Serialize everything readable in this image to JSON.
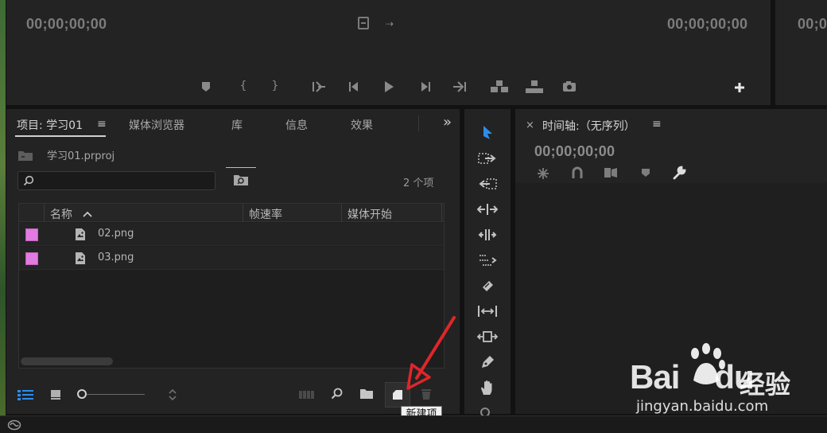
{
  "source_monitor": {
    "timecode_left": "00;00;00;00",
    "timecode_right": "00;00;00;00",
    "controls": [
      "marker-icon",
      "mark-in-icon",
      "mark-out-icon",
      "go-to-in-icon",
      "step-back-icon",
      "play-icon",
      "step-forward-icon",
      "go-to-out-icon",
      "insert-icon",
      "overwrite-icon",
      "export-frame-icon",
      "add-icon"
    ]
  },
  "program_monitor": {
    "timecode": "00;0"
  },
  "project_panel": {
    "tabs": [
      {
        "label": "项目: 学习01",
        "active": true
      },
      {
        "label": "媒体浏览器"
      },
      {
        "label": "库"
      },
      {
        "label": "信息"
      },
      {
        "label": "效果"
      }
    ],
    "menu_glyph": "≡",
    "overflow_glyph": "»",
    "project_file": "学习01.prproj",
    "item_count": "2 个项",
    "columns": [
      "名称",
      "帧速率",
      "媒体开始"
    ],
    "rows": [
      {
        "name": "02.png",
        "label_color": "#e07be0"
      },
      {
        "name": "03.png",
        "label_color": "#e07be0"
      }
    ],
    "tooltip": "新建项"
  },
  "timeline_panel": {
    "close_glyph": "×",
    "title": "时间轴:（无序列）",
    "menu_glyph": "≡",
    "timecode": "00;00;00;00"
  },
  "tools": [
    "selection-tool-icon",
    "track-select-forward-icon",
    "track-select-backward-icon",
    "ripple-edit-icon",
    "rolling-edit-icon",
    "rate-stretch-icon",
    "razor-icon",
    "slip-icon",
    "slide-icon",
    "pen-icon",
    "hand-icon"
  ],
  "colors": {
    "accent_blue": "#2d8ceb",
    "label_violet": "#e07be0",
    "arrow_red": "#e0262a"
  },
  "watermark": {
    "logo_text": "Bai",
    "logo_tail": "du",
    "cn_text": "经验",
    "url": "jingyan.baidu.com"
  }
}
